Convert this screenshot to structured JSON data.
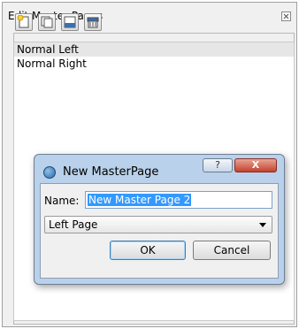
{
  "panel": {
    "title": "Edit Master Pages",
    "toolbar": [
      "new-page-icon",
      "duplicate-page-icon",
      "import-page-icon",
      "delete-page-icon"
    ],
    "list": [
      "Normal Left",
      "Normal Right"
    ],
    "selected_index": 0
  },
  "dialog": {
    "title": "New MasterPage",
    "help_label": "?",
    "close_label": "X",
    "name_label": "Name:",
    "name_value": "New Master Page 2",
    "select_value": "Left Page",
    "ok_label": "OK",
    "cancel_label": "Cancel"
  },
  "colors": {
    "dialog_frame": "#b9d1ea",
    "close_red": "#c4412f",
    "selection_blue": "#3399ff"
  }
}
